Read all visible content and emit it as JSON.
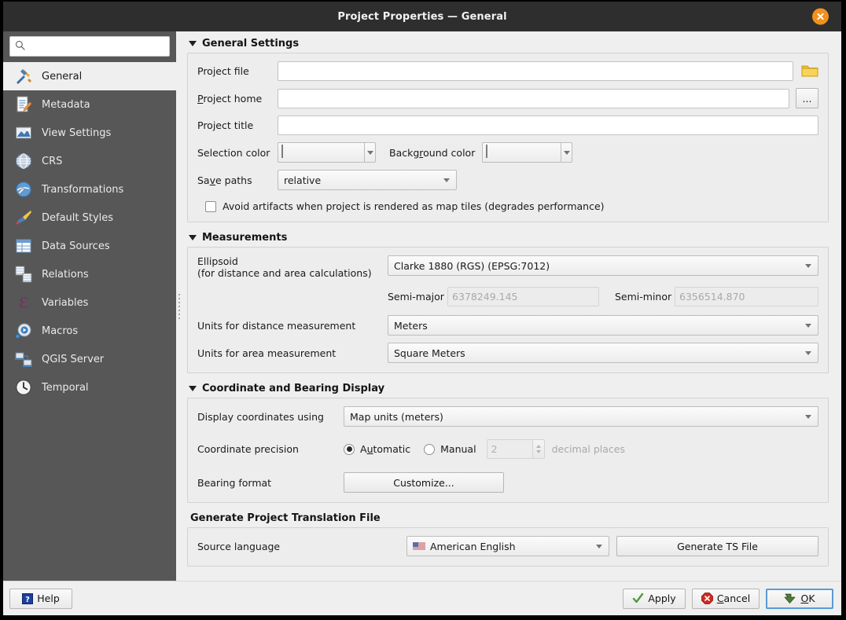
{
  "window": {
    "title": "Project Properties — General",
    "close_icon": "close-icon"
  },
  "sidebar": {
    "search": {
      "value": "",
      "placeholder": "",
      "icon": "search-icon"
    },
    "items": [
      {
        "label": "General",
        "icon": "hammer-wrench-icon",
        "selected": true
      },
      {
        "label": "Metadata",
        "icon": "document-edit-icon",
        "selected": false
      },
      {
        "label": "View Settings",
        "icon": "map-view-icon",
        "selected": false
      },
      {
        "label": "CRS",
        "icon": "globe-grid-icon",
        "selected": false
      },
      {
        "label": "Transformations",
        "icon": "globe-transform-icon",
        "selected": false
      },
      {
        "label": "Default Styles",
        "icon": "paintbrush-icon",
        "selected": false
      },
      {
        "label": "Data Sources",
        "icon": "table-icon",
        "selected": false
      },
      {
        "label": "Relations",
        "icon": "relations-icon",
        "selected": false
      },
      {
        "label": "Variables",
        "icon": "epsilon-icon",
        "selected": false
      },
      {
        "label": "Macros",
        "icon": "gear-play-icon",
        "selected": false
      },
      {
        "label": "QGIS Server",
        "icon": "server-icon",
        "selected": false
      },
      {
        "label": "Temporal",
        "icon": "clock-icon",
        "selected": false
      }
    ]
  },
  "general_settings": {
    "title": "General Settings",
    "collapsed": false,
    "project_file": {
      "label": "Project file",
      "value": "",
      "browse_icon": "folder-icon"
    },
    "project_home": {
      "label": "Project home",
      "label_accel": "P",
      "value": "",
      "browse_label": "..."
    },
    "project_title": {
      "label": "Project title",
      "value": ""
    },
    "selection_color": {
      "label": "Selection color",
      "color": "#ffff00"
    },
    "background_color": {
      "label": "Background color",
      "label_accel": "r",
      "color": "#ffffff"
    },
    "save_paths": {
      "label": "Save paths",
      "label_accel": "v",
      "value": "relative"
    },
    "avoid_artifacts": {
      "label": "Avoid artifacts when project is rendered as map tiles (degrades performance)",
      "checked": false
    }
  },
  "measurements": {
    "title": "Measurements",
    "collapsed": false,
    "ellipsoid": {
      "label_line1": "Ellipsoid",
      "label_line2": "(for distance and area calculations)",
      "value": "Clarke 1880 (RGS) (EPSG:7012)"
    },
    "semi_major": {
      "label": "Semi-major",
      "value": "6378249.145",
      "enabled": false
    },
    "semi_minor": {
      "label": "Semi-minor",
      "value": "6356514.870",
      "enabled": false
    },
    "distance_units": {
      "label": "Units for distance measurement",
      "value": "Meters"
    },
    "area_units": {
      "label": "Units for area measurement",
      "value": "Square Meters"
    }
  },
  "coordinate_display": {
    "title": "Coordinate and Bearing Display",
    "collapsed": false,
    "display_coordinates": {
      "label": "Display coordinates using",
      "value": "Map units (meters)"
    },
    "coordinate_precision": {
      "label": "Coordinate precision",
      "automatic_label": "Automatic",
      "automatic_accel": "u",
      "manual_label": "Manual",
      "selected": "automatic",
      "decimal_value": "2",
      "decimal_suffix": "decimal places"
    },
    "bearing_format": {
      "label": "Bearing format",
      "button_label": "Customize..."
    }
  },
  "translation": {
    "title": "Generate Project Translation File",
    "source_language": {
      "label": "Source language",
      "value": "American English",
      "flag_icon": "us-flag-icon"
    },
    "generate_button": "Generate TS File"
  },
  "footer": {
    "help": {
      "label": "Help",
      "icon": "help-icon"
    },
    "apply": {
      "label": "Apply",
      "icon": "check-icon"
    },
    "cancel": {
      "label": "Cancel",
      "icon": "cancel-icon",
      "accel": "C"
    },
    "ok": {
      "label": "OK",
      "icon": "ok-arrow-icon",
      "accel": "O",
      "focused": true
    }
  }
}
